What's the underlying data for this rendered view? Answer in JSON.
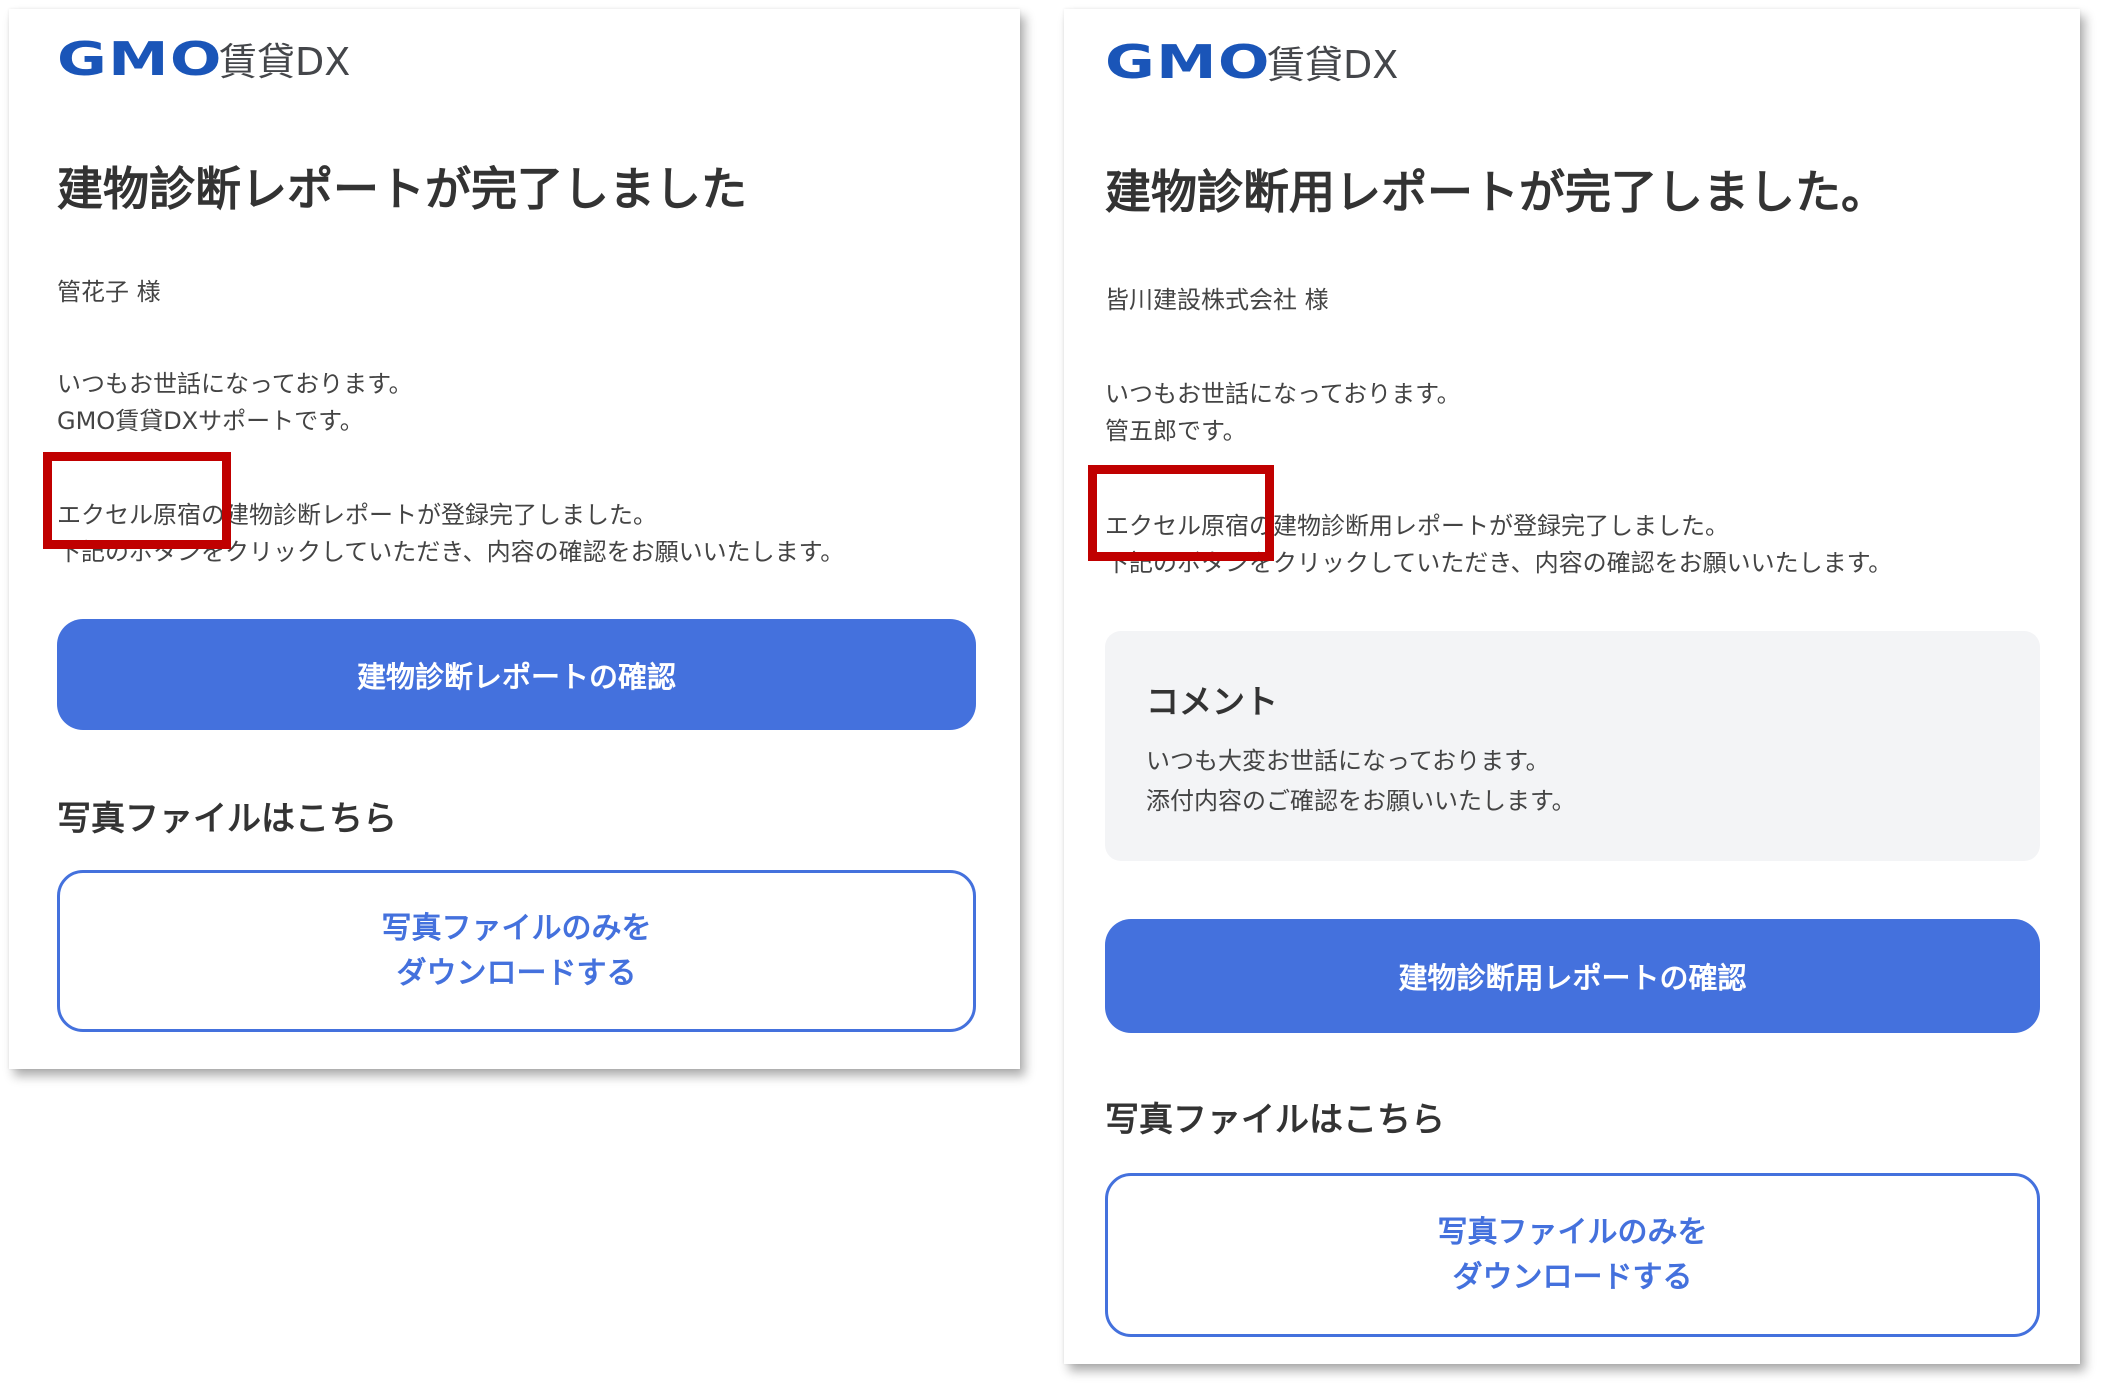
{
  "left_panel": {
    "logo": {
      "mark": "GMO",
      "text": "賃貸DX"
    },
    "title": "建物診断レポートが完了しました",
    "recipient": "管花子 様",
    "greeting": [
      "いつもお世話になっております。",
      "GMO賃貸DXサポートです。"
    ],
    "notice": [
      "エクセル原宿の建物診断レポートが登録完了しました。",
      "下記のボタンをクリックしていただき、内容の確認をお願いいたします。"
    ],
    "primary_button": "建物診断レポートの確認",
    "photo_heading": "写真ファイルはこちら",
    "download_button": [
      "写真ファイルのみを",
      "ダウンロードする"
    ]
  },
  "right_panel": {
    "logo": {
      "mark": "GMO",
      "text": "賃貸DX"
    },
    "title": "建物診断用レポートが完了しました。",
    "recipient": "皆川建設株式会社 様",
    "greeting": [
      "いつもお世話になっております。",
      "管五郎です。"
    ],
    "notice": [
      "エクセル原宿の建物診断用レポートが登録完了しました。",
      "下記のボタンをクリックしていただき、内容の確認をお願いいたします。"
    ],
    "comment": {
      "title": "コメント",
      "lines": [
        "いつも大変お世話になっております。",
        "添付内容のご確認をお願いいたします。"
      ]
    },
    "primary_button": "建物診断用レポートの確認",
    "photo_heading": "写真ファイルはこちら",
    "download_button": [
      "写真ファイルのみを",
      "ダウンロードする"
    ]
  },
  "colors": {
    "brand_blue": "#1a55b8",
    "button_blue": "#4471dd",
    "highlight_red": "#c00000",
    "comment_bg": "#f3f4f6"
  }
}
